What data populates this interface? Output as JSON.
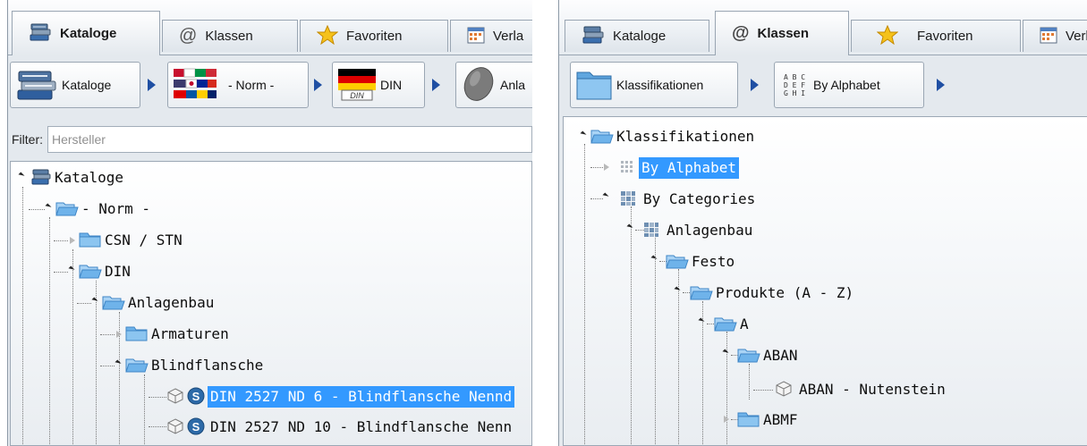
{
  "left_panel": {
    "tabs": [
      "Kataloge",
      "Klassen",
      "Favoriten",
      "Verla"
    ],
    "active_tab": "Kataloge",
    "breadcrumb": [
      "Kataloge",
      "- Norm -",
      "DIN",
      "Anla"
    ],
    "filter": {
      "label": "Filter:",
      "placeholder": "Hersteller",
      "value": ""
    },
    "tree": [
      "Kataloge",
      "- Norm -",
      "CSN / STN",
      "DIN",
      "Anlagenbau",
      "Armaturen",
      "Blindflansche",
      "DIN 2527 ND 6 - Blindflansche Nennd",
      "DIN 2527 ND 10 - Blindflansche Nenn"
    ],
    "selected_item": "DIN 2527 ND 6 - Blindflansche Nennd"
  },
  "right_panel": {
    "tabs": [
      "Kataloge",
      "Klassen",
      "Favoriten",
      "Verla"
    ],
    "active_tab": "Klassen",
    "breadcrumb": [
      "Klassifikationen",
      "By Alphabet"
    ],
    "alphabet_glyph": [
      "A B C",
      "D E F",
      "G H I"
    ],
    "tree": [
      "Klassifikationen",
      "By Alphabet",
      "By Categories",
      "Anlagenbau",
      "Festo",
      "Produkte (A - Z)",
      "A",
      "ABAN",
      "ABAN - Nutenstein",
      "ABMF"
    ],
    "selected_item": "By Alphabet"
  },
  "colors": {
    "selection": "#3399ff",
    "breadcrumb_arrow": "#1f4fa3",
    "folder": "#6fb3ea",
    "panel_background": "#e4e9ee"
  },
  "icons": [
    "books-icon",
    "at-sign-icon",
    "star-icon",
    "calendar-icon",
    "flags-icon",
    "german-flag-icon",
    "grey-disc-icon",
    "folder-icon",
    "open-folder-icon",
    "dotted-grid-icon",
    "categories-icon",
    "cube-icon",
    "s-badge-icon",
    "alphabet-icon",
    "arrow-right-icon"
  ]
}
